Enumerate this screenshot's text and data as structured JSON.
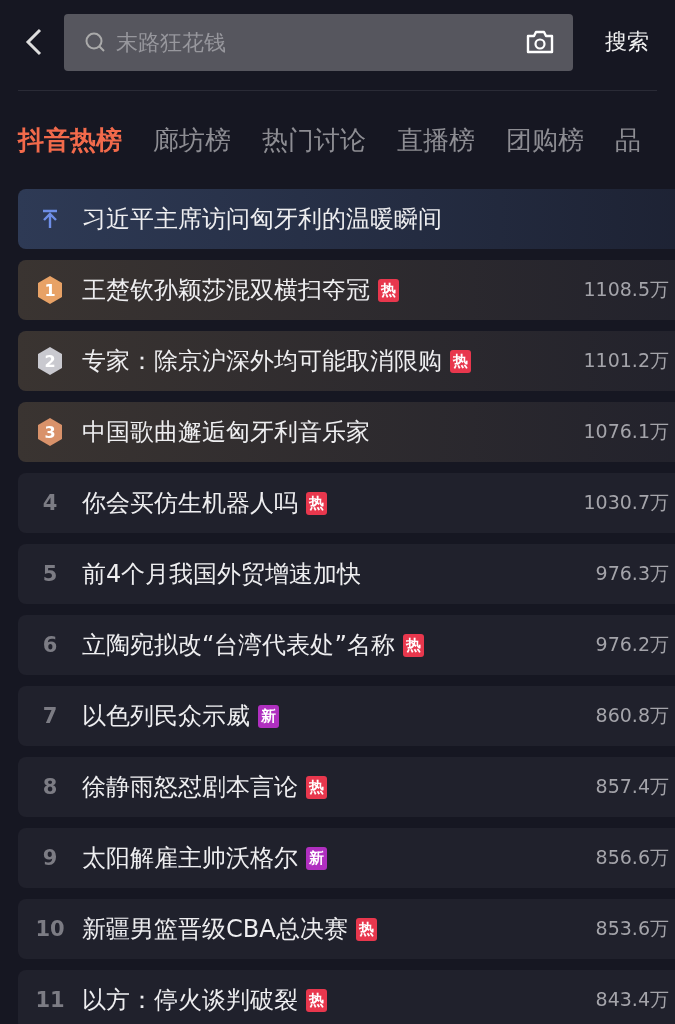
{
  "search": {
    "placeholder": "末路狂花钱",
    "button": "搜索"
  },
  "tabs": [
    {
      "label": "抖音热榜",
      "selected": true
    },
    {
      "label": "廊坊榜",
      "selected": false
    },
    {
      "label": "热门讨论",
      "selected": false
    },
    {
      "label": "直播榜",
      "selected": false
    },
    {
      "label": "团购榜",
      "selected": false
    },
    {
      "label": "品",
      "selected": false
    }
  ],
  "pinned": {
    "title": "习近平主席访问匈牙利的温暖瞬间"
  },
  "rows": [
    {
      "rank": "1",
      "kind": "medal",
      "color": "#e8a266",
      "title": "王楚钦孙颖莎混双横扫夺冠",
      "badge": {
        "text": "热",
        "color": "#e8374d"
      },
      "heat": "1108.5万"
    },
    {
      "rank": "2",
      "kind": "medal",
      "color": "#c9c9cf",
      "title": "专家：除京沪深外均可能取消限购",
      "badge": {
        "text": "热",
        "color": "#e8374d"
      },
      "heat": "1101.2万"
    },
    {
      "rank": "3",
      "kind": "medal",
      "color": "#d9926a",
      "title": "中国歌曲邂逅匈牙利音乐家",
      "heat": "1076.1万"
    },
    {
      "rank": "4",
      "kind": "number",
      "title": "你会买仿生机器人吗",
      "badge": {
        "text": "热",
        "color": "#e8374d"
      },
      "heat": "1030.7万"
    },
    {
      "rank": "5",
      "kind": "number",
      "title": "前4个月我国外贸增速加快",
      "heat": "976.3万"
    },
    {
      "rank": "6",
      "kind": "number",
      "title": "立陶宛拟改“台湾代表处”名称",
      "badge": {
        "text": "热",
        "color": "#e8374d"
      },
      "heat": "976.2万"
    },
    {
      "rank": "7",
      "kind": "number",
      "title": "以色列民众示威",
      "badge": {
        "text": "新",
        "color": "#b02fc0"
      },
      "heat": "860.8万"
    },
    {
      "rank": "8",
      "kind": "number",
      "title": "徐静雨怒怼剧本言论",
      "badge": {
        "text": "热",
        "color": "#e8374d"
      },
      "heat": "857.4万"
    },
    {
      "rank": "9",
      "kind": "number",
      "title": "太阳解雇主帅沃格尔",
      "badge": {
        "text": "新",
        "color": "#b02fc0"
      },
      "heat": "856.6万"
    },
    {
      "rank": "10",
      "kind": "number",
      "title": "新疆男篮晋级CBA总决赛",
      "badge": {
        "text": "热",
        "color": "#e8374d"
      },
      "heat": "853.6万"
    },
    {
      "rank": "11",
      "kind": "number",
      "title": "以方：停火谈判破裂",
      "badge": {
        "text": "热",
        "color": "#e8374d"
      },
      "heat": "843.4万"
    }
  ]
}
